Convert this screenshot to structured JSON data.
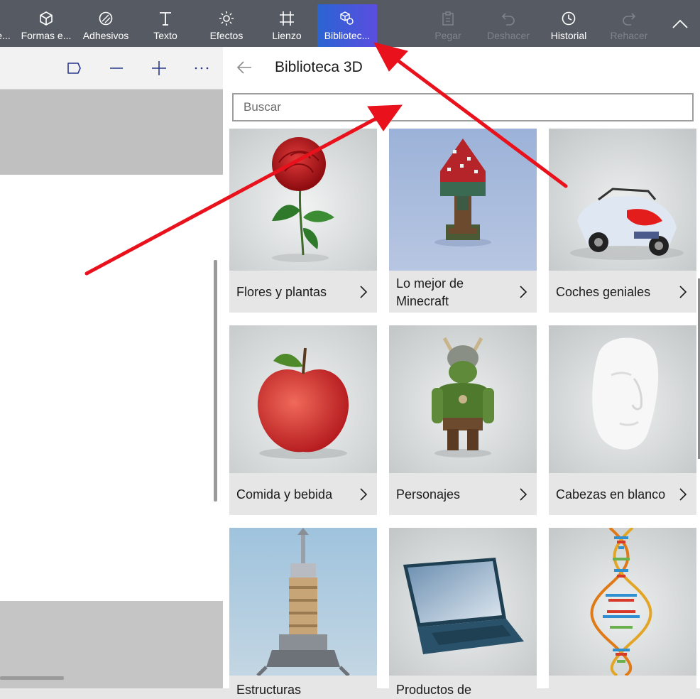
{
  "toolbar": {
    "items": [
      {
        "label": "e...",
        "icon": "truncated-tool-icon"
      },
      {
        "label": "Formas e...",
        "icon": "cube-icon"
      },
      {
        "label": "Adhesivos",
        "icon": "sticker-icon"
      },
      {
        "label": "Texto",
        "icon": "text-t-icon"
      },
      {
        "label": "Efectos",
        "icon": "sun-effects-icon"
      },
      {
        "label": "Lienzo",
        "icon": "canvas-hash-icon"
      },
      {
        "label": "Bibliotec...",
        "icon": "library-3d-icon"
      }
    ],
    "actions": [
      {
        "label": "Pegar",
        "icon": "paste-icon",
        "enabled": false
      },
      {
        "label": "Deshacer",
        "icon": "undo-icon",
        "enabled": false
      },
      {
        "label": "Historial",
        "icon": "history-icon",
        "enabled": true
      },
      {
        "label": "Rehacer",
        "icon": "redo-icon",
        "enabled": false
      }
    ],
    "collapse_icon": "chevron-up-icon",
    "active_gradient": [
      "#2a64d2",
      "#5b4ee0"
    ]
  },
  "canvas_tools": [
    "flag-icon",
    "minus-icon",
    "plus-icon",
    "more-icon"
  ],
  "panel": {
    "title": "Biblioteca 3D",
    "search_placeholder": "Buscar",
    "categories": [
      {
        "label": "Flores y plantas",
        "thumb": "rose"
      },
      {
        "label": "Lo mejor de Minecraft",
        "thumb": "minecraft-tree"
      },
      {
        "label": "Coches geniales",
        "thumb": "car"
      },
      {
        "label": "Comida y bebida",
        "thumb": "apple"
      },
      {
        "label": "Personajes",
        "thumb": "orc"
      },
      {
        "label": "Cabezas en blanco",
        "thumb": "blank-head"
      },
      {
        "label": "Estructuras",
        "thumb": "tower"
      },
      {
        "label": "Productos de",
        "thumb": "laptop"
      },
      {
        "label": "",
        "thumb": "dna"
      }
    ]
  },
  "colors": {
    "annotation_arrow": "#e8111c",
    "toolbar_bg": "#565a62"
  }
}
